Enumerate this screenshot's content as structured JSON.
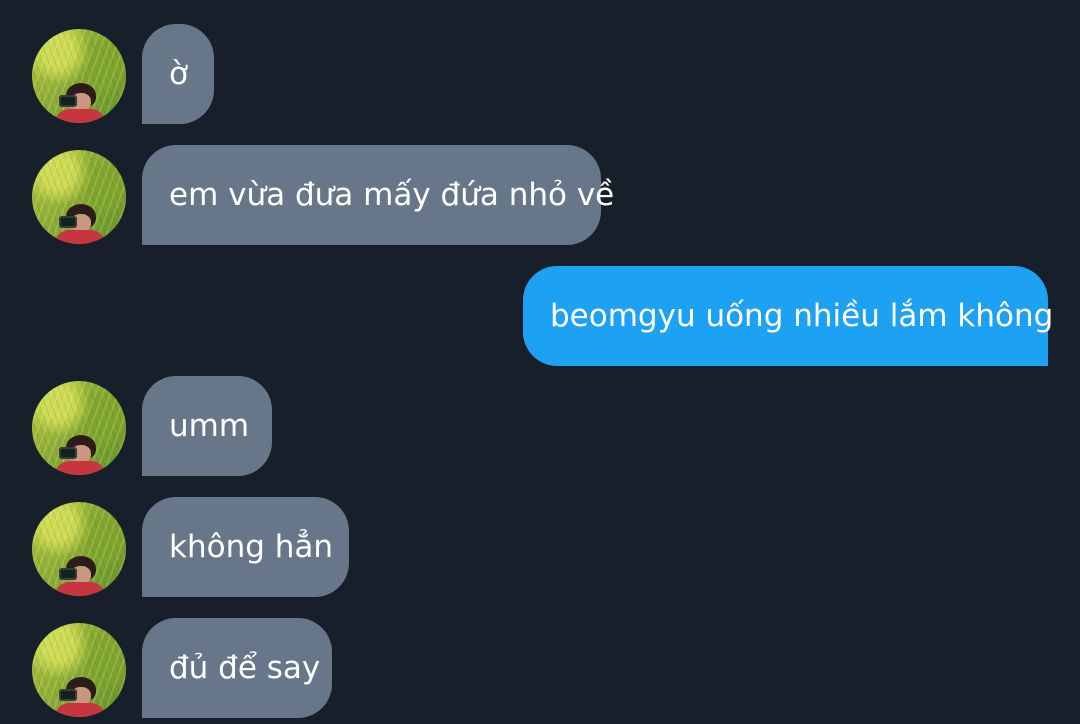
{
  "messages": [
    {
      "sender": "contact",
      "text": "ờ"
    },
    {
      "sender": "contact",
      "text": "em vừa đưa mấy đứa nhỏ về"
    },
    {
      "sender": "me",
      "text": "beomgyu uống nhiều lắm không"
    },
    {
      "sender": "contact",
      "text": "umm"
    },
    {
      "sender": "contact",
      "text": "không hẳn"
    },
    {
      "sender": "contact",
      "text": "đủ để say"
    }
  ],
  "colors": {
    "background": "#17202a",
    "incoming_bubble": "#677789",
    "outgoing_bubble": "#1da1f2",
    "text": "#ffffff"
  },
  "icons": {
    "contact_avatar": "profile-photo-icon"
  }
}
